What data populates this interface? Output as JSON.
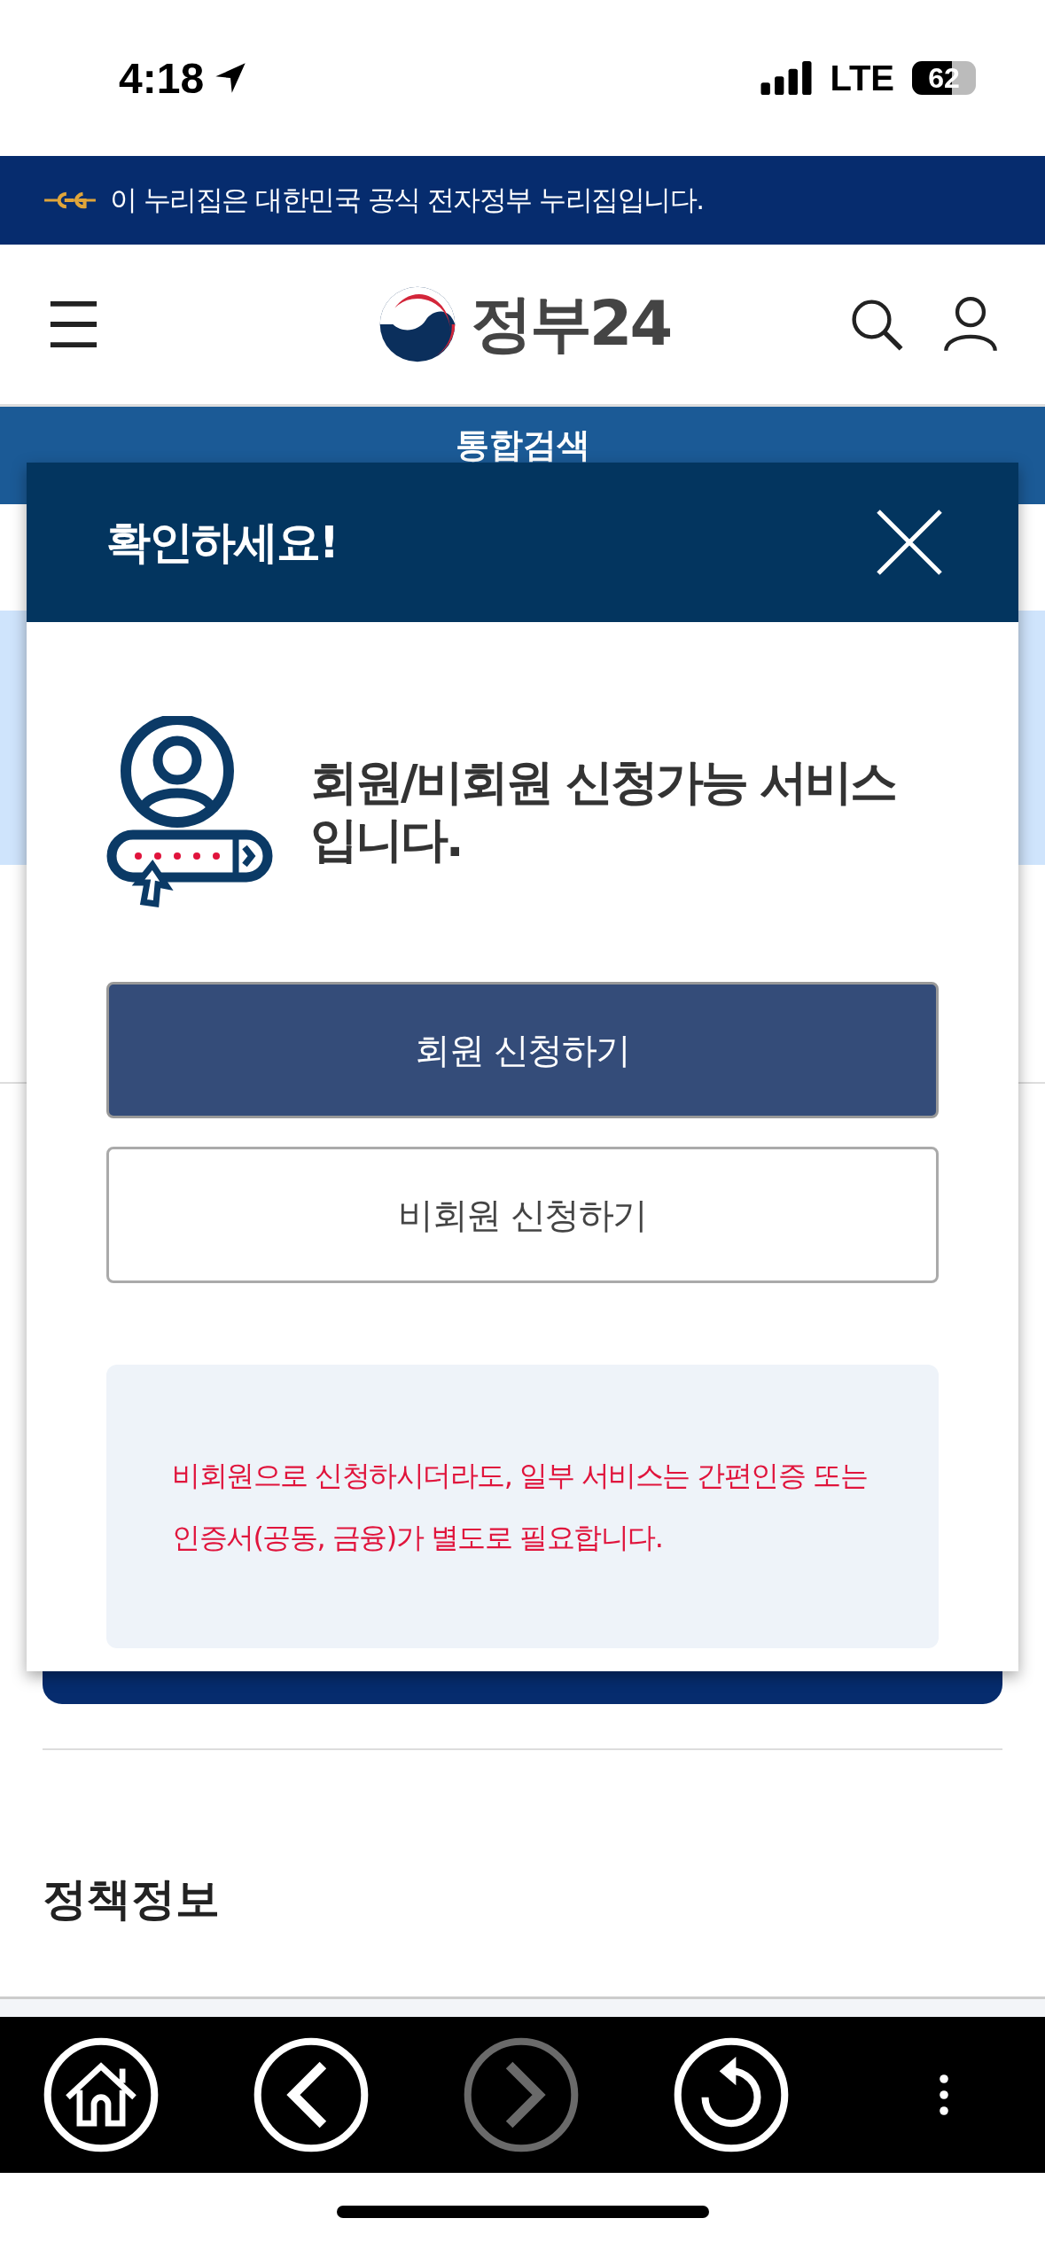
{
  "status_bar": {
    "time": "4:18",
    "network": "LTE",
    "battery": "62"
  },
  "gov_banner": {
    "text": "이 누리집은 대한민국 공식 전자정부 누리집입니다."
  },
  "header": {
    "logo_text": "정부24"
  },
  "subheader": {
    "title": "통합검색"
  },
  "page": {
    "section_title": "정책정보"
  },
  "dialog": {
    "title": "확인하세요!",
    "message": "회원/비회원 신청가능 서비스 입니다.",
    "buttons": [
      {
        "label": "회원 신청하기",
        "kind": "primary"
      },
      {
        "label": "비회원 신청하기",
        "kind": "secondary"
      }
    ],
    "notice": "비회원으로 신청하시더라도, 일부 서비스는 간편인증 또는 인증서(공동, 금융)가 별도로 필요합니다."
  },
  "browser_toolbar": {
    "buttons": [
      {
        "kind": "home",
        "disabled": false
      },
      {
        "kind": "back",
        "disabled": false
      },
      {
        "kind": "forward",
        "disabled": true
      },
      {
        "kind": "reload",
        "disabled": false
      },
      {
        "kind": "more",
        "disabled": false
      }
    ]
  }
}
